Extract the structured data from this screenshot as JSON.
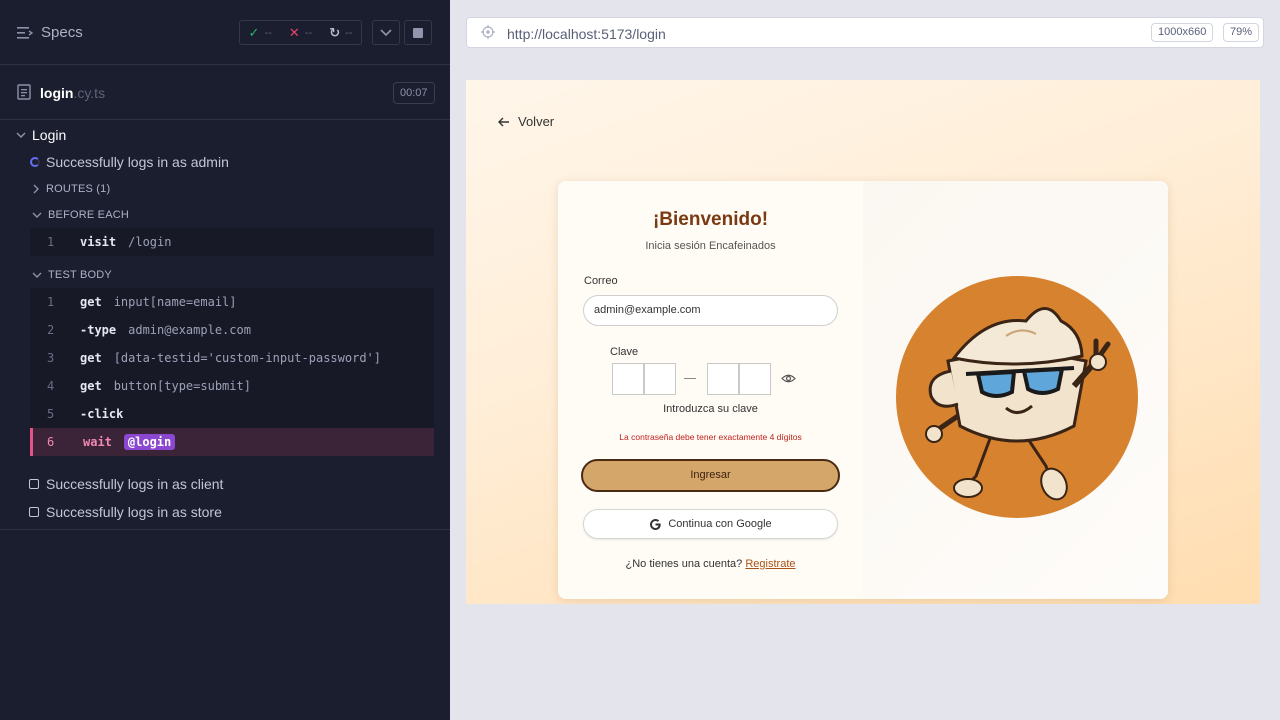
{
  "reporter": {
    "specs_label": "Specs",
    "stats": {
      "passed": "--",
      "failed": "--",
      "pending": "--"
    },
    "spec": {
      "name": "login",
      "ext": ".cy.ts",
      "duration": "00:07"
    },
    "suite_title": "Login",
    "running_test": "Successfully logs in as admin",
    "routes_label": "ROUTES (1)",
    "before_each_label": "BEFORE EACH",
    "before_each_cmds": [
      {
        "num": "1",
        "name": "visit",
        "msg": "/login"
      }
    ],
    "test_body_label": "TEST BODY",
    "test_body_cmds": [
      {
        "num": "1",
        "name": "get",
        "msg": "input[name=email]"
      },
      {
        "num": "2",
        "name": "-type",
        "msg": "admin@example.com"
      },
      {
        "num": "3",
        "name": "get",
        "msg": "[data-testid='custom-input-password']"
      },
      {
        "num": "4",
        "name": "get",
        "msg": "button[type=submit]"
      },
      {
        "num": "5",
        "name": "-click",
        "msg": ""
      },
      {
        "num": "6",
        "name": "wait",
        "msg": "@login"
      }
    ],
    "pending_tests": [
      "Successfully logs in as client",
      "Successfully logs in as store"
    ]
  },
  "browser": {
    "url": "http://localhost:5173/login",
    "viewport": "1000x660",
    "zoom": "79%"
  },
  "app": {
    "back_label": "Volver",
    "title": "¡Bienvenido!",
    "subtitle": "Inicia sesión Encafeinados",
    "email_label": "Correo",
    "email_value": "admin@example.com",
    "pin_label": "Clave",
    "pin_hint": "Introduzca su clave",
    "error": "La contraseña debe tener exactamente 4 dígitos",
    "submit_label": "Ingresar",
    "google_label": "Continua con Google",
    "register_prompt": "¿No tienes una cuenta?",
    "register_link": "Registrate"
  },
  "colors": {
    "reporter_bg": "#1b1e2e",
    "active_command": "#e55486",
    "alias": "#8b47cf",
    "brand_brown": "#7a3a12",
    "mascot_circle": "#d6822f"
  }
}
